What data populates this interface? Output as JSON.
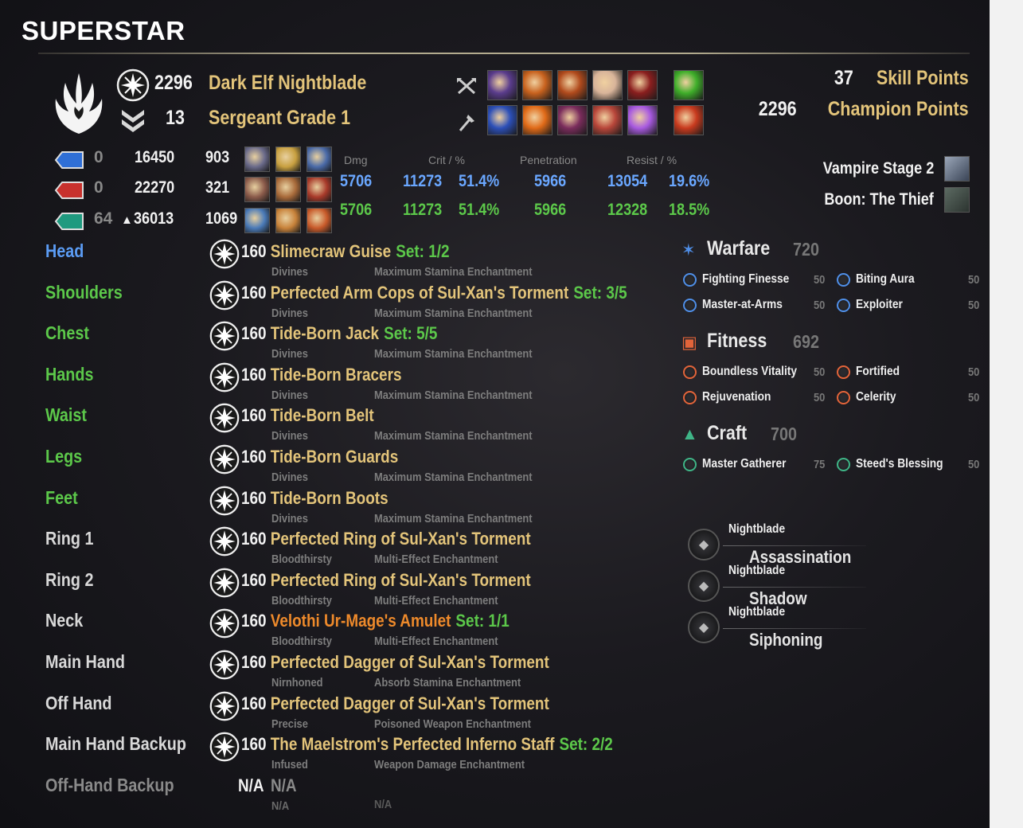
{
  "header": {
    "title": "SUPERSTAR"
  },
  "character": {
    "champion_points": "2296",
    "race_class": "Dark Elf Nightblade",
    "rank_number": "13",
    "rank_title": "Sergeant Grade 1"
  },
  "points": {
    "skill_points_value": "37",
    "skill_points_label": "Skill Points",
    "champion_points_value": "2296",
    "champion_points_label": "Champion Points"
  },
  "effects": {
    "vampire": "Vampire Stage 2",
    "boon": "Boon: The Thief"
  },
  "resources": [
    {
      "name": "magicka",
      "color": "#2f6fd6",
      "attribute": "0",
      "max": "16450",
      "recovery": "903",
      "prefix": ""
    },
    {
      "name": "health",
      "color": "#c8312d",
      "attribute": "0",
      "max": "22270",
      "recovery": "321",
      "prefix": ""
    },
    {
      "name": "stamina",
      "color": "#1f9a7f",
      "attribute": "64",
      "max": "36013",
      "recovery": "1069",
      "prefix": "▲"
    }
  ],
  "stat_headers": {
    "dmg": "Dmg",
    "crit": "Crit / %",
    "penetration": "Penetration",
    "resist": "Resist / %"
  },
  "stats": {
    "spell": {
      "dmg": "5706",
      "crit": "11273",
      "crit_pct": "51.4%",
      "pen": "5966",
      "resist": "13054",
      "resist_pct": "19.6%"
    },
    "weapon": {
      "dmg": "5706",
      "crit": "11273",
      "crit_pct": "51.4%",
      "pen": "5966",
      "resist": "12328",
      "resist_pct": "18.5%"
    }
  },
  "equipment": [
    {
      "slot": "Head",
      "slot_color": "#5b9cf4",
      "cp": "160",
      "name": "Slimecraw Guise",
      "name_color": "#e3c47a",
      "set": "Set: 1/2",
      "trait": "Divines",
      "enchant": "Maximum Stamina Enchantment"
    },
    {
      "slot": "Shoulders",
      "slot_color": "#5cc84a",
      "cp": "160",
      "name": "Perfected Arm Cops of Sul-Xan's Torment",
      "name_color": "#e3c47a",
      "set": "Set: 3/5",
      "trait": "Divines",
      "enchant": "Maximum Stamina Enchantment"
    },
    {
      "slot": "Chest",
      "slot_color": "#5cc84a",
      "cp": "160",
      "name": "Tide-Born Jack",
      "name_color": "#e3c47a",
      "set": "Set: 5/5",
      "trait": "Divines",
      "enchant": "Maximum Stamina Enchantment"
    },
    {
      "slot": "Hands",
      "slot_color": "#5cc84a",
      "cp": "160",
      "name": "Tide-Born Bracers",
      "name_color": "#e3c47a",
      "set": "",
      "trait": "Divines",
      "enchant": "Maximum Stamina Enchantment"
    },
    {
      "slot": "Waist",
      "slot_color": "#5cc84a",
      "cp": "160",
      "name": "Tide-Born Belt",
      "name_color": "#e3c47a",
      "set": "",
      "trait": "Divines",
      "enchant": "Maximum Stamina Enchantment"
    },
    {
      "slot": "Legs",
      "slot_color": "#5cc84a",
      "cp": "160",
      "name": "Tide-Born Guards",
      "name_color": "#e3c47a",
      "set": "",
      "trait": "Divines",
      "enchant": "Maximum Stamina Enchantment"
    },
    {
      "slot": "Feet",
      "slot_color": "#5cc84a",
      "cp": "160",
      "name": "Tide-Born Boots",
      "name_color": "#e3c47a",
      "set": "",
      "trait": "Divines",
      "enchant": "Maximum Stamina Enchantment"
    },
    {
      "slot": "Ring 1",
      "slot_color": "#d8d8d8",
      "cp": "160",
      "name": "Perfected Ring of Sul-Xan's Torment",
      "name_color": "#e3c47a",
      "set": "",
      "trait": "Bloodthirsty",
      "enchant": "Multi-Effect Enchantment"
    },
    {
      "slot": "Ring 2",
      "slot_color": "#d8d8d8",
      "cp": "160",
      "name": "Perfected Ring of Sul-Xan's Torment",
      "name_color": "#e3c47a",
      "set": "",
      "trait": "Bloodthirsty",
      "enchant": "Multi-Effect Enchantment"
    },
    {
      "slot": "Neck",
      "slot_color": "#d8d8d8",
      "cp": "160",
      "name": "Velothi Ur-Mage's Amulet",
      "name_color": "#ee8a2b",
      "set": "Set: 1/1",
      "trait": "Bloodthirsty",
      "enchant": "Multi-Effect Enchantment"
    },
    {
      "slot": "Main Hand",
      "slot_color": "#d8d8d8",
      "cp": "160",
      "name": "Perfected Dagger of Sul-Xan's Torment",
      "name_color": "#e3c47a",
      "set": "",
      "trait": "Nirnhoned",
      "enchant": "Absorb Stamina Enchantment"
    },
    {
      "slot": "Off Hand",
      "slot_color": "#d8d8d8",
      "cp": "160",
      "name": "Perfected Dagger of Sul-Xan's Torment",
      "name_color": "#e3c47a",
      "set": "",
      "trait": "Precise",
      "enchant": "Poisoned Weapon Enchantment"
    },
    {
      "slot": "Main Hand Backup",
      "slot_color": "#d8d8d8",
      "cp": "160",
      "name": "The Maelstrom's Perfected Inferno Staff",
      "name_color": "#e3c47a",
      "set": "Set: 2/2",
      "trait": "Infused",
      "enchant": "Weapon Damage Enchantment"
    }
  ],
  "offhand_backup": {
    "slot": "Off-Hand Backup",
    "level": "N/A",
    "name": "N/A",
    "trait": "N/A",
    "enchant": "N/A"
  },
  "champion": [
    {
      "title": "Warfare",
      "total": "720",
      "color": "#4f8fe8",
      "icon": "warfare-icon",
      "perks": [
        {
          "name": "Fighting Finesse",
          "value": "50"
        },
        {
          "name": "Biting Aura",
          "value": "50"
        },
        {
          "name": "Master-at-Arms",
          "value": "50"
        },
        {
          "name": "Exploiter",
          "value": "50"
        }
      ]
    },
    {
      "title": "Fitness",
      "total": "692",
      "color": "#e2643a",
      "icon": "fitness-icon",
      "perks": [
        {
          "name": "Boundless Vitality",
          "value": "50"
        },
        {
          "name": "Fortified",
          "value": "50"
        },
        {
          "name": "Rejuvenation",
          "value": "50"
        },
        {
          "name": "Celerity",
          "value": "50"
        }
      ]
    },
    {
      "title": "Craft",
      "total": "700",
      "color": "#3fb587",
      "icon": "craft-icon",
      "perks": [
        {
          "name": "Master Gatherer",
          "value": "75"
        },
        {
          "name": "Steed's Blessing",
          "value": "50"
        }
      ]
    }
  ],
  "skill_lines": [
    {
      "class": "Nightblade",
      "line": "Assassination"
    },
    {
      "class": "Nightblade",
      "line": "Shadow"
    },
    {
      "class": "Nightblade",
      "line": "Siphoning"
    }
  ],
  "skills": {
    "front": [
      {
        "icon": "skill-icon",
        "color": "#5a3c8c"
      },
      {
        "icon": "skill-icon",
        "color": "#c8621e"
      },
      {
        "icon": "skill-icon",
        "color": "#b04a1c"
      },
      {
        "icon": "skill-icon",
        "color": "#d8b49a"
      },
      {
        "icon": "skill-icon",
        "color": "#8a1e1e"
      },
      {
        "icon": "ultimate-icon",
        "color": "#3fae2a"
      }
    ],
    "back": [
      {
        "icon": "skill-icon",
        "color": "#2c4fb8"
      },
      {
        "icon": "skill-icon",
        "color": "#e06a18"
      },
      {
        "icon": "skill-icon",
        "color": "#7a2c5c"
      },
      {
        "icon": "skill-icon",
        "color": "#b8463a"
      },
      {
        "icon": "skill-icon",
        "color": "#a85ae0"
      },
      {
        "icon": "ultimate-icon",
        "color": "#c83a1e"
      }
    ]
  }
}
